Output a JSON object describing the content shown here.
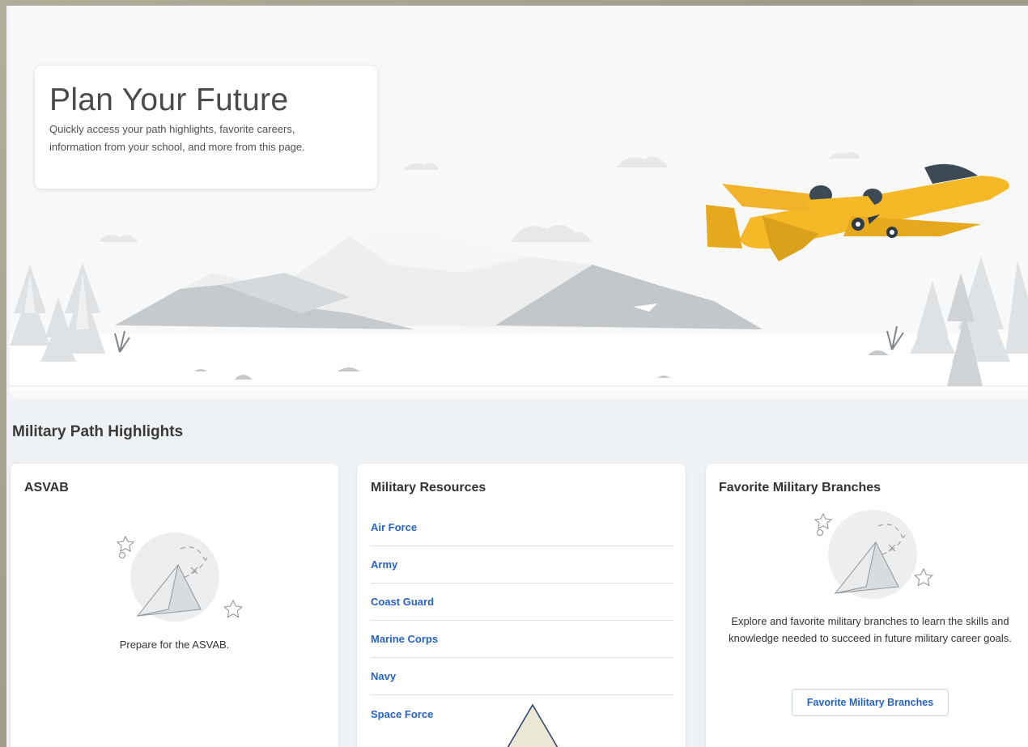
{
  "hero": {
    "title": "Plan Your Future",
    "subtitle": "Quickly access your path highlights, favorite careers, information from your school, and more from this page."
  },
  "section": {
    "title": "Military Path Highlights"
  },
  "asvab_card": {
    "title": "ASVAB",
    "text": "Prepare for the ASVAB.",
    "illustration": "paper-plane-illustration"
  },
  "resources_card": {
    "title": "Military Resources",
    "links": [
      "Air Force",
      "Army",
      "Coast Guard",
      "Marine Corps",
      "Navy",
      "Space Force"
    ]
  },
  "favorites_card": {
    "title": "Favorite Military Branches",
    "text": "Explore and favorite military branches to learn the skills and knowledge needed to succeed in future military career goals.",
    "button_label": "Favorite Military Branches",
    "illustration": "paper-plane-illustration"
  },
  "colors": {
    "link": "#2563c9",
    "airplane": "#f5b827",
    "background": "#eef2f4"
  }
}
